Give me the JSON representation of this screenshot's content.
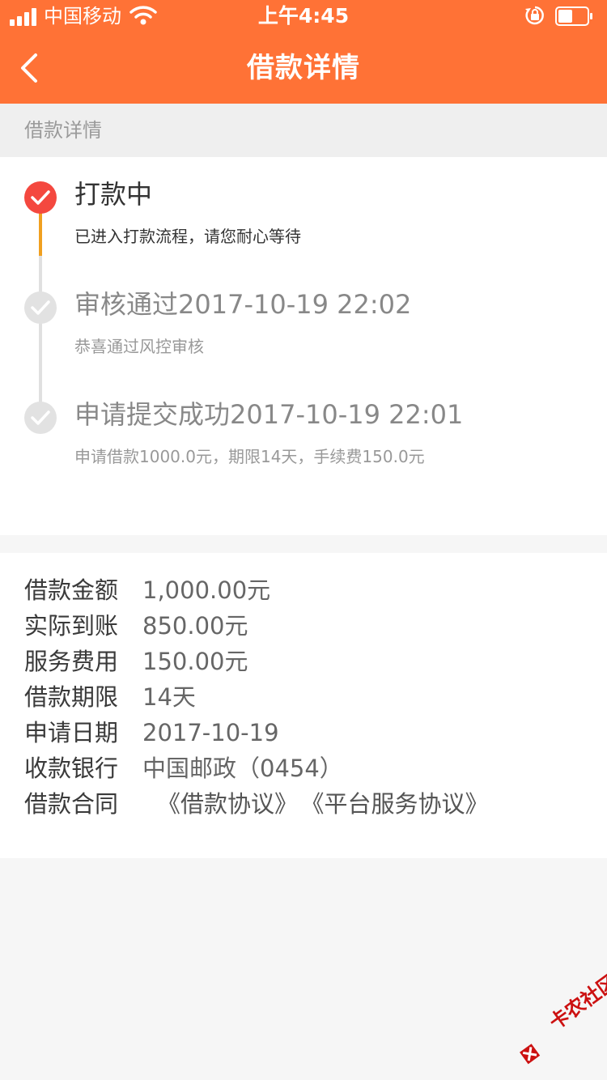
{
  "status_bar": {
    "carrier": "中国移动",
    "time": "上午4:45",
    "battery_level": 0.5
  },
  "nav": {
    "title": "借款详情"
  },
  "section": {
    "title": "借款详情"
  },
  "timeline": [
    {
      "title": "打款中",
      "desc": "已进入打款流程，请您耐心等待",
      "state": "active"
    },
    {
      "title": "审核通过2017-10-19 22:02",
      "desc": "恭喜通过风控审核",
      "state": "done"
    },
    {
      "title": "申请提交成功2017-10-19 22:01",
      "desc": "申请借款1000.0元，期限14天，手续费150.0元",
      "state": "done"
    }
  ],
  "details": {
    "amount": {
      "label": "借款金额",
      "value": "1,000.00元"
    },
    "received": {
      "label": "实际到账",
      "value": "850.00元"
    },
    "fee": {
      "label": "服务费用",
      "value": "150.00元"
    },
    "term": {
      "label": "借款期限",
      "value": "14天"
    },
    "date": {
      "label": "申请日期",
      "value": "2017-10-19"
    },
    "bank": {
      "label": "收款银行",
      "value": "中国邮政（0454）"
    },
    "contract": {
      "label": "借款合同",
      "link1": "《借款协议》",
      "link2": "《平台服务协议》"
    }
  },
  "watermark": {
    "text": "卡农社区"
  },
  "colors": {
    "brand": "#ff7236",
    "active_dot": "#f4483f",
    "active_line": "#f0a020",
    "inactive_dot": "#e2e2e2"
  }
}
